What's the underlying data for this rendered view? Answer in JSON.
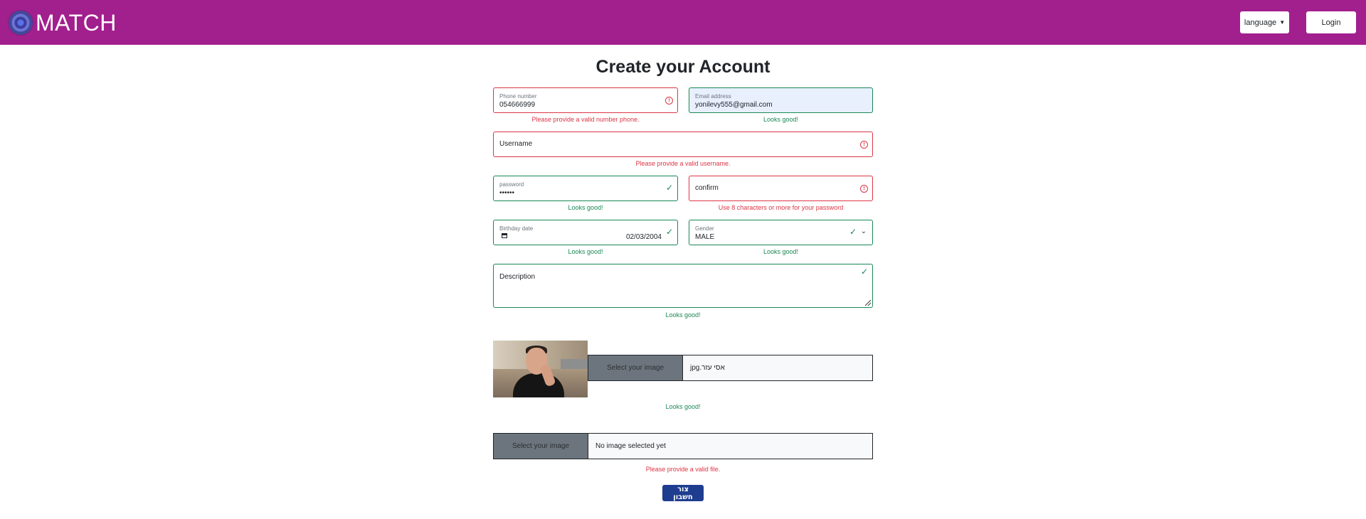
{
  "navbar": {
    "brand": "MATCH",
    "language_label": "language",
    "login_label": "Login",
    "color": "#a21f8e"
  },
  "form": {
    "title": "Create your Account",
    "phone": {
      "label": "Phone number",
      "value": "054666999",
      "error": "Please provide a valid number phone."
    },
    "email": {
      "label": "Email address",
      "value": "yonilevy555@gmail.com",
      "feedback": "Looks good!"
    },
    "username": {
      "placeholder": "Username",
      "error": "Please provide a valid username."
    },
    "password": {
      "label": "password",
      "value": "••••••",
      "feedback": "Looks good!"
    },
    "confirm": {
      "placeholder": "confirm",
      "error": "Use 8 characters or more for your password"
    },
    "birthday": {
      "label": "Birthday date",
      "value": "02/03/2004",
      "feedback": "Looks good!"
    },
    "gender": {
      "label": "Gender",
      "value": "MALE",
      "feedback": "Looks good!"
    },
    "description": {
      "placeholder": "Description",
      "feedback": "Looks good!"
    },
    "image1": {
      "button": "Select your image",
      "filename": "אסי עזר.jpg",
      "feedback": "Looks good!"
    },
    "image2": {
      "button": "Select your image",
      "filename": "No image selected yet",
      "error": "Please provide a valid file."
    },
    "submit_label": "צור חשבון"
  },
  "colors": {
    "invalid": "#dc3545",
    "valid": "#198754",
    "submit": "#1e3d8f"
  }
}
